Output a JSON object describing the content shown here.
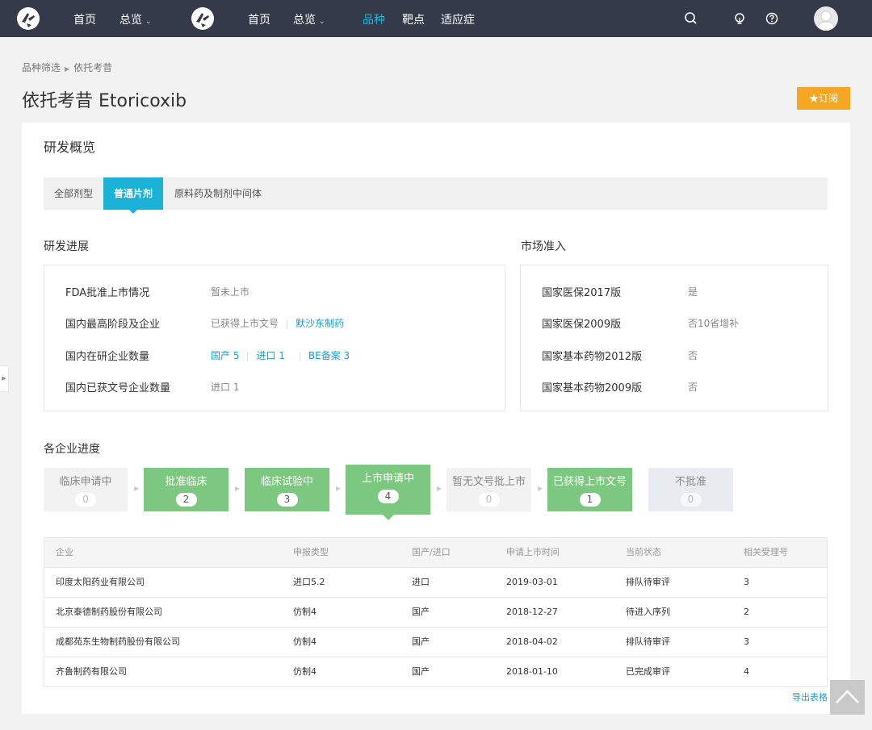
{
  "topbar": {
    "nav": [
      "首页",
      "总览",
      "首页",
      "总览",
      "品种",
      "靶点",
      "适应症"
    ],
    "active_nav": "品种"
  },
  "breadcrumb": {
    "parent": "品种筛选",
    "current": "依托考昔"
  },
  "page_title": "依托考昔 Etoricoxib",
  "subscribe_label": "★订阅",
  "card_title": "研发概览",
  "tabs": [
    "全部剂型",
    "普通片剂",
    "原料药及制剂中间体"
  ],
  "active_tab": "普通片剂",
  "rd_progress": {
    "heading": "研发进展",
    "rows": [
      {
        "label": "FDA批准上市情况",
        "value": "暂未上市"
      },
      {
        "label": "国内最高阶段及企业",
        "value": "已获得上市文号",
        "link": "默沙东制药"
      },
      {
        "label": "国内在研企业数量",
        "links": [
          "国产 5",
          "进口 1",
          "BE备案 3"
        ]
      },
      {
        "label": "国内已获文号企业数量",
        "links": [
          "进口 1"
        ]
      }
    ]
  },
  "market": {
    "heading": "市场准入",
    "rows": [
      {
        "label": "国家医保2017版",
        "value": "是",
        "is_link": true
      },
      {
        "label": "国家医保2009版",
        "value": "否10省增补",
        "is_link": true
      },
      {
        "label": "国家基本药物2012版",
        "value": "否",
        "is_link": false
      },
      {
        "label": "国家基本药物2009版",
        "value": "否",
        "is_link": false
      }
    ]
  },
  "company_progress": {
    "heading": "各企业进度",
    "stages": [
      {
        "name": "临床申请中",
        "count": "0"
      },
      {
        "name": "批准临床",
        "count": "2"
      },
      {
        "name": "临床试验中",
        "count": "3"
      },
      {
        "name": "上市申请中",
        "count": "4"
      },
      {
        "name": "暂无文号批上市",
        "count": "0"
      },
      {
        "name": "已获得上市文号",
        "count": "1"
      },
      {
        "name": "不批准",
        "count": "0"
      }
    ],
    "selected_stage": "上市申请中"
  },
  "table": {
    "headers": [
      "企业",
      "申报类型",
      "国产/进口",
      "申请上市时间",
      "当前状态",
      "相关受理号"
    ],
    "rows": [
      [
        "印度太阳药业有限公司",
        "进口5.2",
        "进口",
        "2019-03-01",
        "排队待审评",
        "3"
      ],
      [
        "北京泰德制药股份有限公司",
        "仿制4",
        "国产",
        "2018-12-27",
        "待进入序列",
        "2"
      ],
      [
        "成都苑东生物制药股份有限公司",
        "仿制4",
        "国产",
        "2018-04-02",
        "排队待审评",
        "3"
      ],
      [
        "齐鲁制药有限公司",
        "仿制4",
        "国产",
        "2018-01-10",
        "已完成审评",
        "4"
      ]
    ]
  },
  "export_label": "导出表格",
  "colors": {
    "topbar": "#343a4a",
    "accent": "#1ab2d6",
    "stage_green": "#7dc880",
    "subscribe": "#f5a623",
    "link": "#1a9fd0"
  },
  "icons": [
    "logo-icon",
    "search-icon",
    "bulb-icon",
    "help-icon",
    "avatar-icon",
    "back-to-top-icon"
  ]
}
